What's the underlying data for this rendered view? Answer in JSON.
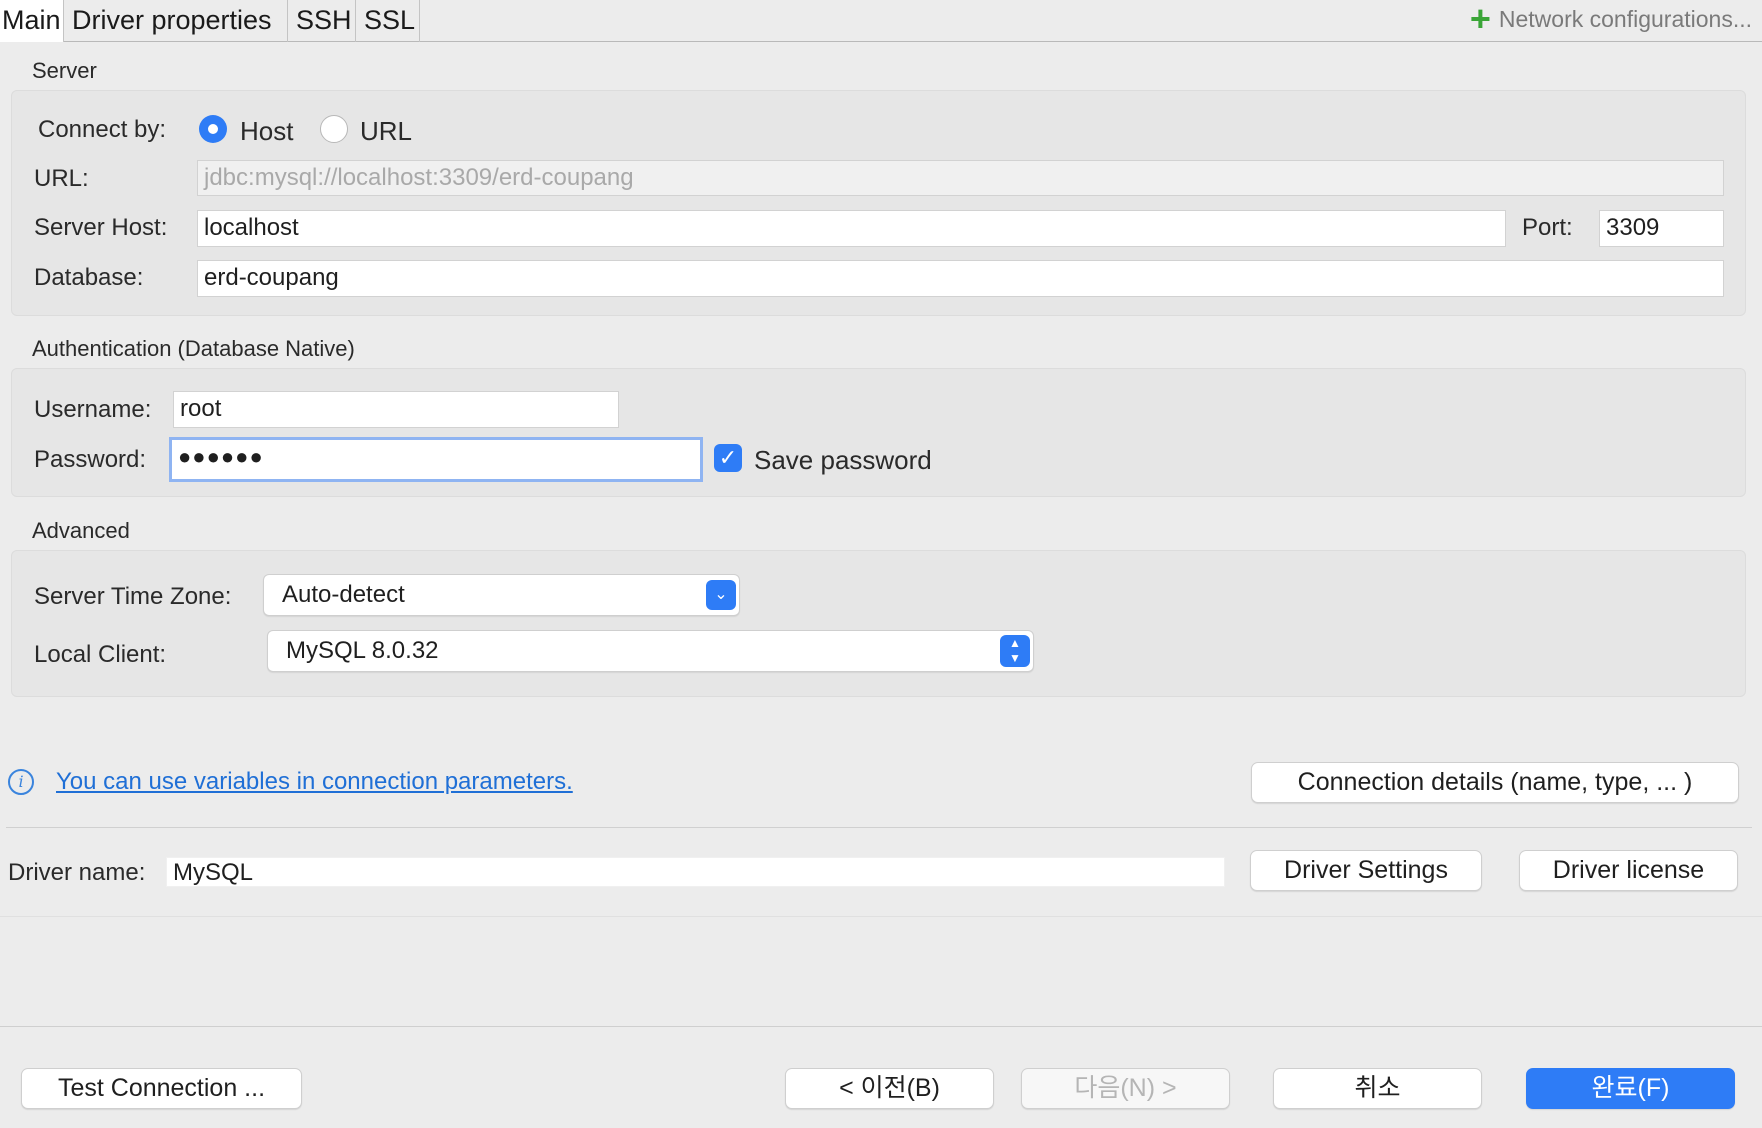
{
  "tabs": [
    {
      "label": "Main",
      "active": true
    },
    {
      "label": "Driver properties"
    },
    {
      "label": "SSH"
    },
    {
      "label": "SSL"
    }
  ],
  "network_configurations": "Network configurations...",
  "server": {
    "title": "Server",
    "connect_by_label": "Connect by:",
    "host_option": "Host",
    "url_option": "URL",
    "url_label": "URL:",
    "url_value": "jdbc:mysql://localhost:3309/erd-coupang",
    "host_label": "Server Host:",
    "host_value": "localhost",
    "port_label": "Port:",
    "port_value": "3309",
    "database_label": "Database:",
    "database_value": "erd-coupang"
  },
  "auth": {
    "title": "Authentication (Database Native)",
    "username_label": "Username:",
    "username_value": "root",
    "password_label": "Password:",
    "password_value": "●●●●●●",
    "save_password_label": "Save password",
    "save_password_checked": true
  },
  "advanced": {
    "title": "Advanced",
    "timezone_label": "Server Time Zone:",
    "timezone_value": "Auto-detect",
    "local_client_label": "Local Client:",
    "local_client_value": "MySQL 8.0.32"
  },
  "info_link": "You can use variables in connection parameters.",
  "connection_details_button": "Connection details (name, type, ... )",
  "driver": {
    "name_label": "Driver name:",
    "name_value": "MySQL",
    "settings_button": "Driver Settings",
    "license_button": "Driver license"
  },
  "footer": {
    "test_connection": "Test Connection ...",
    "back": "< 이전(B)",
    "next": "다음(N) >",
    "cancel": "취소",
    "finish": "완료(F)"
  },
  "colors": {
    "accent": "#2e7cf6",
    "link": "#1f6fd6",
    "plus": "#3aa537"
  }
}
